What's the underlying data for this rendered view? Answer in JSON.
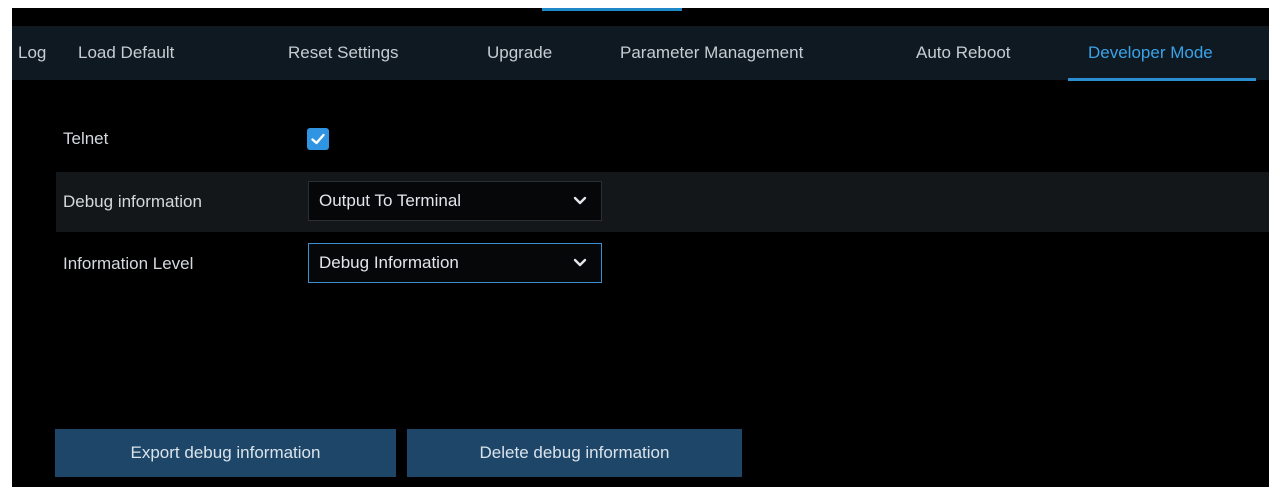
{
  "tabs": [
    {
      "label": "Log",
      "active": false
    },
    {
      "label": "Load Default",
      "active": false
    },
    {
      "label": "Reset Settings",
      "active": false
    },
    {
      "label": "Upgrade",
      "active": false
    },
    {
      "label": "Parameter Management",
      "active": false
    },
    {
      "label": "Auto Reboot",
      "active": false
    },
    {
      "label": "Developer Mode",
      "active": true
    }
  ],
  "telnet": {
    "label": "Telnet",
    "checked": true
  },
  "debug_information": {
    "label": "Debug information",
    "value": "Output To Terminal"
  },
  "information_level": {
    "label": "Information Level",
    "value": "Debug Information"
  },
  "buttons": {
    "export_label": "Export debug information",
    "delete_label": "Delete debug information"
  },
  "colors": {
    "accent": "#3aa3e8",
    "background": "#000000",
    "tabbar": "#0f1922",
    "button": "#1e4668",
    "checkbox": "#2f95e3"
  },
  "icons": {
    "checkbox": "checkmark-icon",
    "dropdown": "chevron-down-icon"
  }
}
